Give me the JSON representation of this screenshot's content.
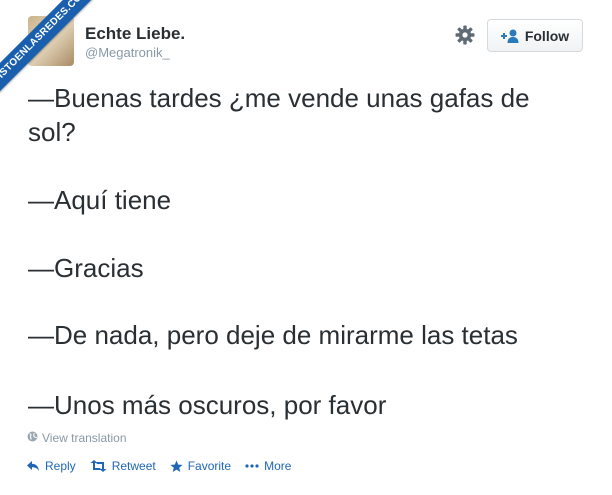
{
  "watermark": {
    "text": "VISTOENLASREDES.COM"
  },
  "header": {
    "display_name": "Echte Liebe.",
    "handle": "@Megatronik_",
    "follow_label": "Follow"
  },
  "tweet": {
    "lines": [
      "—Buenas tardes ¿me vende unas gafas de",
      "sol?",
      "—Aquí tiene",
      "—Gracias",
      "—De nada, pero deje de mirarme las tetas",
      "—Unos más oscuros, por favor"
    ],
    "translate_label": "View translation"
  },
  "actions": {
    "reply": "Reply",
    "retweet": "Retweet",
    "favorite": "Favorite",
    "more": "More"
  },
  "colors": {
    "text": "#292f33",
    "muted": "#8899a6",
    "link": "#1f66b5",
    "ribbon": "#1a5fae"
  },
  "icons": [
    "globe-icon",
    "gear-icon",
    "add-user-icon",
    "reply-icon",
    "retweet-icon",
    "star-icon",
    "more-dots-icon"
  ]
}
